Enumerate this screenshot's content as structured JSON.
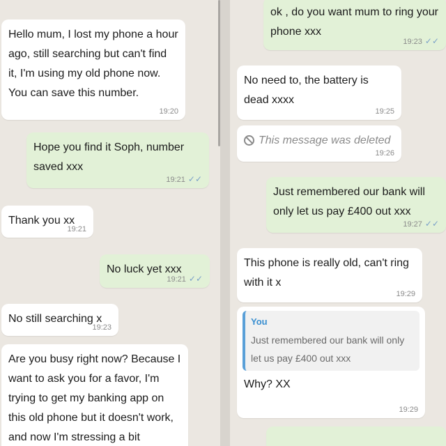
{
  "left": {
    "messages": [
      {
        "text": "Hello mum, I lost my phone a hour ago, still searching but can't find it, I'm using my old phone now. You can save this number.",
        "time": "19:20"
      },
      {
        "text": "Hope you find it Soph, number saved xxx",
        "time": "19:21",
        "tick": "✓✓"
      },
      {
        "text": "Thank you xx",
        "time": "19:21"
      },
      {
        "text": "No luck yet xxx",
        "time": "19:21",
        "tick": "✓✓"
      },
      {
        "text": "No still searching x",
        "time": "19:23"
      },
      {
        "text": "Are you busy right now? Because I want to ask you for a favor, I'm trying to get my banking app on this old phone but it doesn't work, and now I'm stressing a bit because I have to pay a bill"
      }
    ]
  },
  "right": {
    "messages": [
      {
        "text": "ok , do you want mum to ring your phone xxx",
        "time": "19:23",
        "tick": "✓✓"
      },
      {
        "text": "No need to, the battery is dead xxxx",
        "time": "19:25"
      },
      {
        "text": "This message was deleted",
        "time": "19:26"
      },
      {
        "text": "Just remembered our bank will only let us pay £400 out xxx",
        "time": "19:27",
        "tick": "✓✓"
      },
      {
        "text": "This phone is really old, can't ring with it x",
        "time": "19:29"
      },
      {
        "quote_author": "You",
        "quote_text": "Just remembered our bank will only let us pay £400 out xxx",
        "text": "Why? XX",
        "time": "19:29"
      }
    ]
  }
}
